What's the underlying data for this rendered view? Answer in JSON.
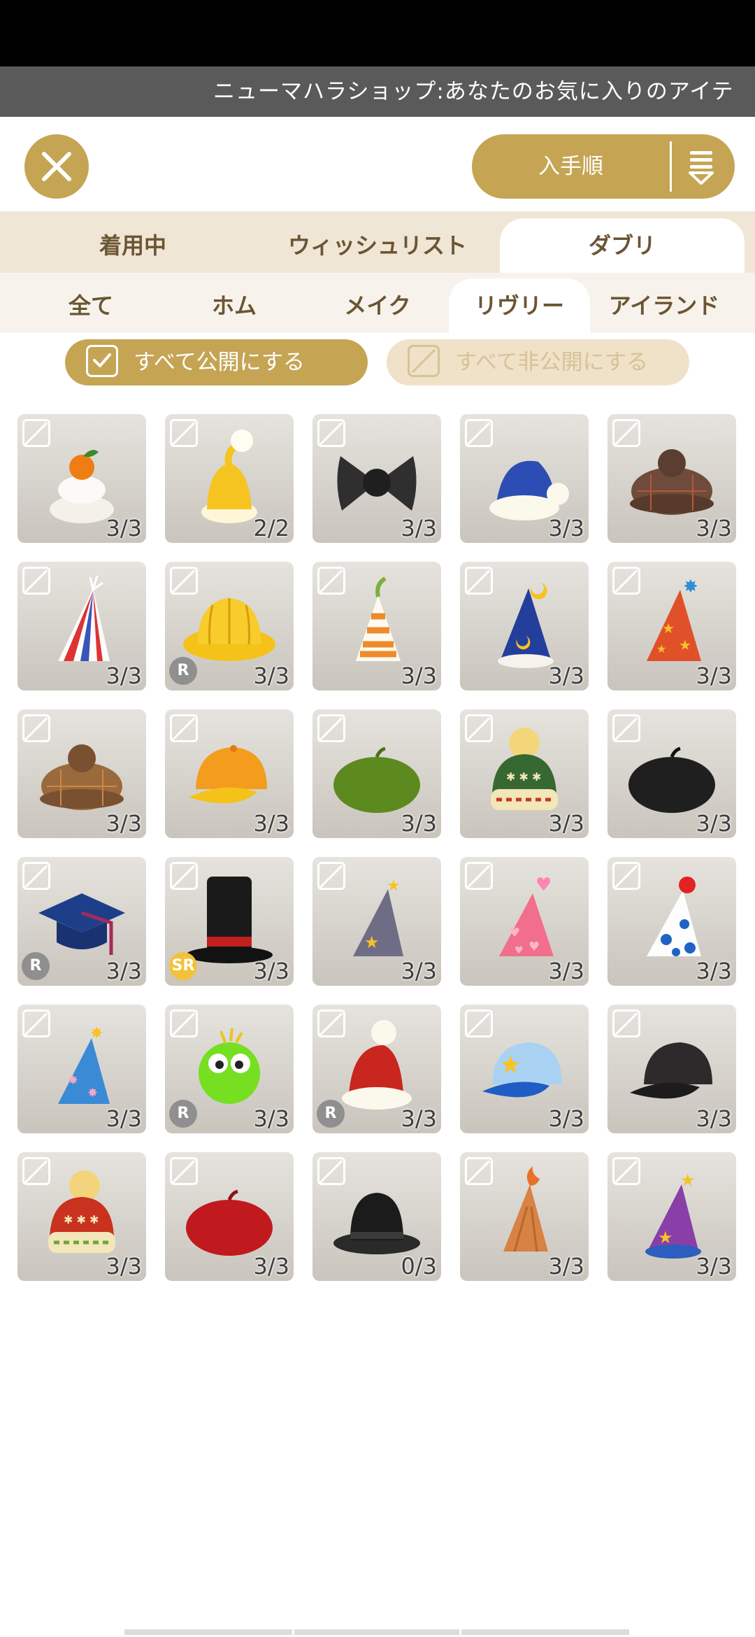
{
  "marquee": {
    "text": "ニューマハラショップ:あなたのお気に入りのアイテ"
  },
  "toolbar": {
    "sort_label": "入手順"
  },
  "main_tabs": [
    {
      "label": "着用中"
    },
    {
      "label": "ウィッシュリスト"
    },
    {
      "label": "ダブリ",
      "active": true
    }
  ],
  "sub_tabs": [
    {
      "label": "全て"
    },
    {
      "label": "ホム"
    },
    {
      "label": "メイク"
    },
    {
      "label": "リヴリー",
      "active": true
    },
    {
      "label": "アイランド"
    }
  ],
  "bulk": {
    "publish_all": "すべて公開にする",
    "unpublish_all": "すべて非公開にする"
  },
  "colors": {
    "accent": "#c5a454",
    "accent_light": "#efe2c9",
    "rarity_r": "#8f8f8f",
    "rarity_sr": "#f3c23a"
  },
  "items": [
    {
      "name": "kagami-mochi-hat",
      "qty": "3/3"
    },
    {
      "name": "yellow-nightcap",
      "qty": "2/2"
    },
    {
      "name": "black-ribbon",
      "qty": "3/3"
    },
    {
      "name": "blue-santa-hat",
      "qty": "3/3"
    },
    {
      "name": "brown-plaid-casquette",
      "qty": "3/3"
    },
    {
      "name": "tricolor-stripe-hat",
      "qty": "3/3"
    },
    {
      "name": "yellow-school-hat",
      "qty": "3/3",
      "rarity": "R"
    },
    {
      "name": "orange-stripe-cone-hat",
      "qty": "3/3"
    },
    {
      "name": "moon-wizard-hat",
      "qty": "3/3"
    },
    {
      "name": "star-party-hat",
      "qty": "3/3"
    },
    {
      "name": "tan-plaid-casquette",
      "qty": "3/3"
    },
    {
      "name": "orange-cap",
      "qty": "3/3"
    },
    {
      "name": "green-beret",
      "qty": "3/3"
    },
    {
      "name": "green-knit-pompom",
      "qty": "3/3"
    },
    {
      "name": "black-beret",
      "qty": "3/3"
    },
    {
      "name": "graduation-cap",
      "qty": "3/3",
      "rarity": "R"
    },
    {
      "name": "black-top-hat",
      "qty": "3/3",
      "rarity": "SR"
    },
    {
      "name": "gray-star-wizard-hat",
      "qty": "3/3"
    },
    {
      "name": "pink-heart-hat",
      "qty": "3/3"
    },
    {
      "name": "blue-dot-clown-hat",
      "qty": "3/3"
    },
    {
      "name": "sparkle-party-hat",
      "qty": "3/3"
    },
    {
      "name": "green-fluffy-monster",
      "qty": "3/3",
      "rarity": "R"
    },
    {
      "name": "red-santa-hat",
      "qty": "3/3",
      "rarity": "R"
    },
    {
      "name": "star-baseball-cap",
      "qty": "3/3"
    },
    {
      "name": "black-baseball-cap",
      "qty": "3/3"
    },
    {
      "name": "red-knit-pompom",
      "qty": "3/3"
    },
    {
      "name": "red-beret",
      "qty": "3/3"
    },
    {
      "name": "black-bowler-hat",
      "qty": "0/3"
    },
    {
      "name": "flame-hat",
      "qty": "3/3"
    },
    {
      "name": "purple-star-wizard-hat",
      "qty": "3/3"
    }
  ]
}
